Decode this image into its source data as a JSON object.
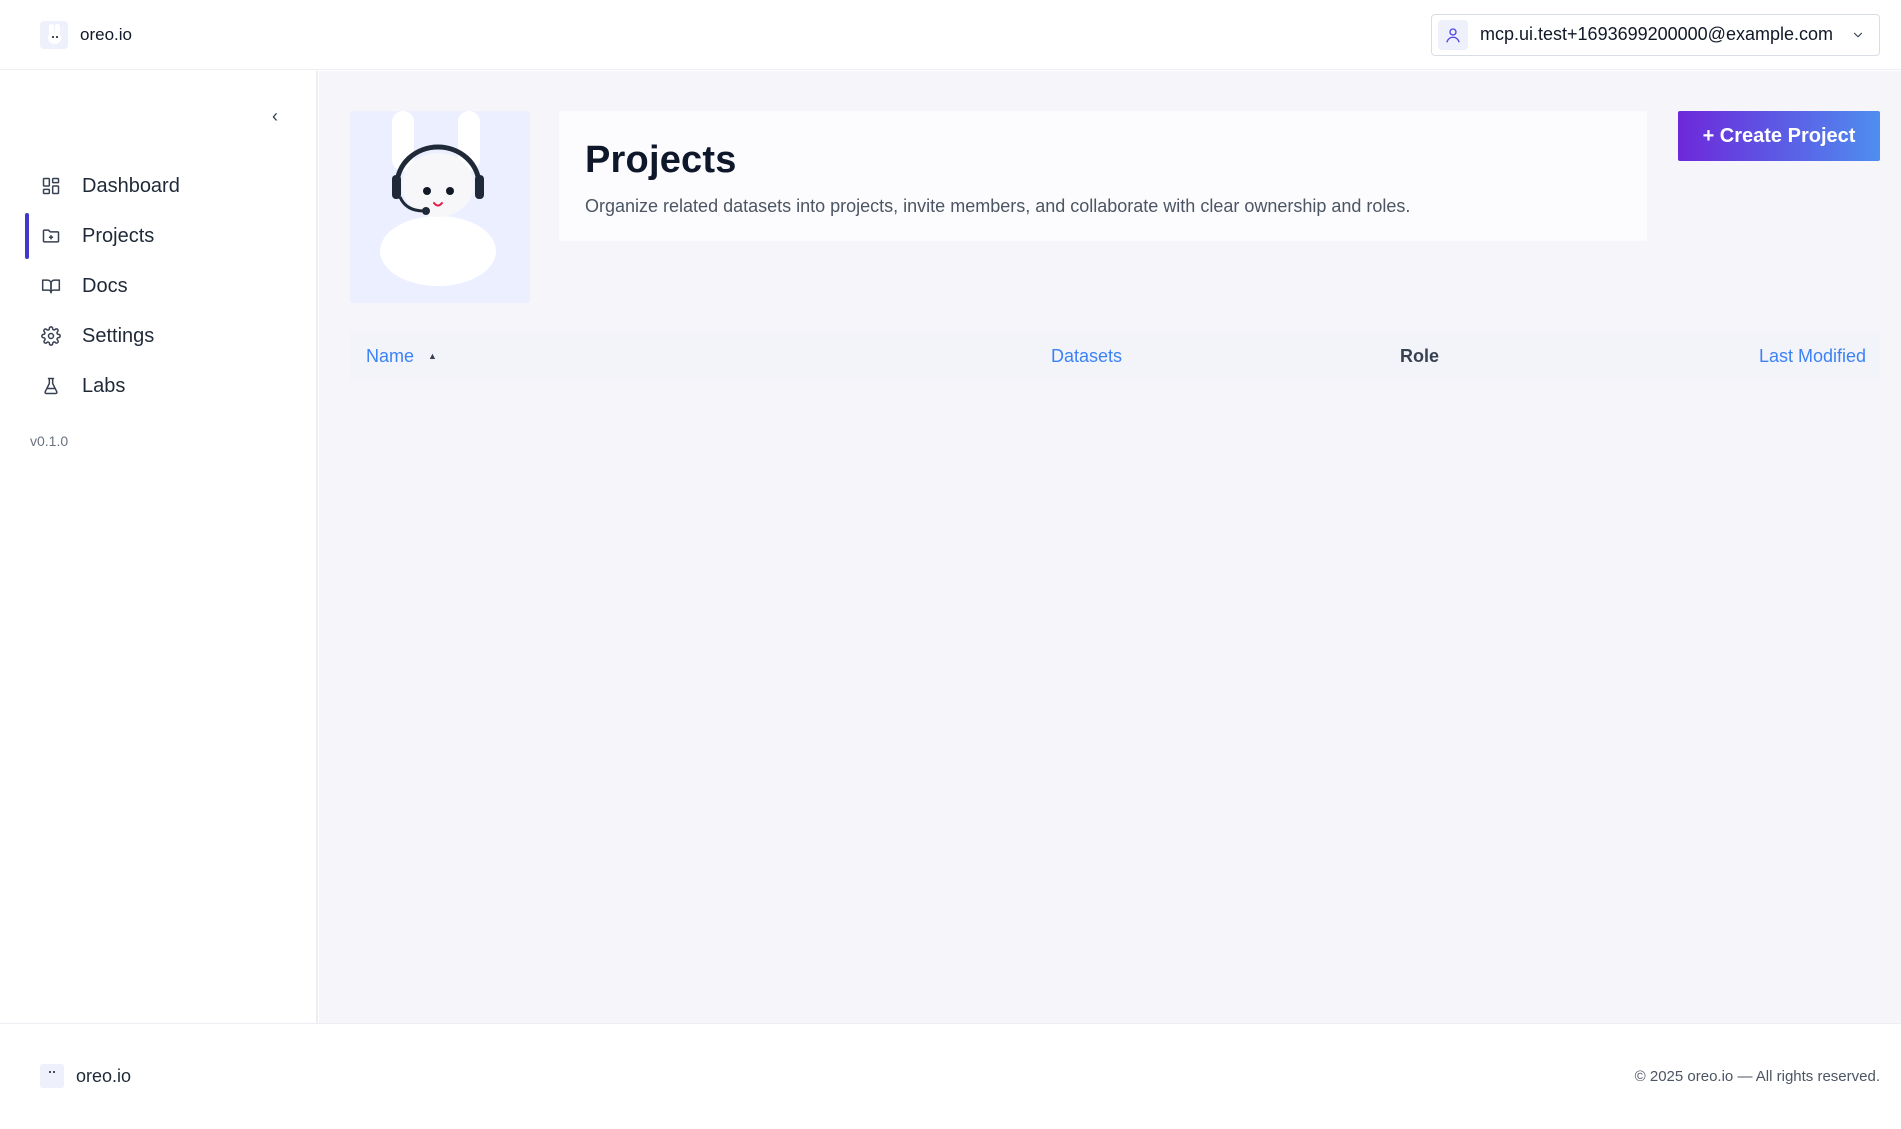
{
  "header": {
    "brand_name": "oreo.io",
    "user_email": "mcp.ui.test+1693699200000@example.com"
  },
  "sidebar": {
    "collapse_glyph": "‹",
    "items": [
      {
        "label": "Dashboard",
        "icon": "dashboard-icon",
        "active": false
      },
      {
        "label": "Projects",
        "icon": "folder-plus-icon",
        "active": true
      },
      {
        "label": "Docs",
        "icon": "book-icon",
        "active": false
      },
      {
        "label": "Settings",
        "icon": "gear-icon",
        "active": false
      },
      {
        "label": "Labs",
        "icon": "flask-icon",
        "active": false
      }
    ],
    "version": "v0.1.0"
  },
  "main": {
    "title": "Projects",
    "description": "Organize related datasets into projects, invite members, and collaborate with clear ownership and roles.",
    "create_button": "+ Create Project",
    "table": {
      "columns": [
        {
          "label": "Name",
          "sortable": true,
          "sorted": "asc"
        },
        {
          "label": "Datasets",
          "sortable": true
        },
        {
          "label": "Role",
          "sortable": false
        },
        {
          "label": "Last Modified",
          "sortable": true
        }
      ],
      "rows": []
    }
  },
  "footer": {
    "brand_name": "oreo.io",
    "copyright": "© 2025 oreo.io — All rights reserved."
  },
  "colors": {
    "accent": "#4338ca",
    "link": "#3b82f6",
    "button_gradient_start": "#6d28d9",
    "button_gradient_end": "#4f8ef0",
    "main_bg": "#f6f6fa"
  }
}
